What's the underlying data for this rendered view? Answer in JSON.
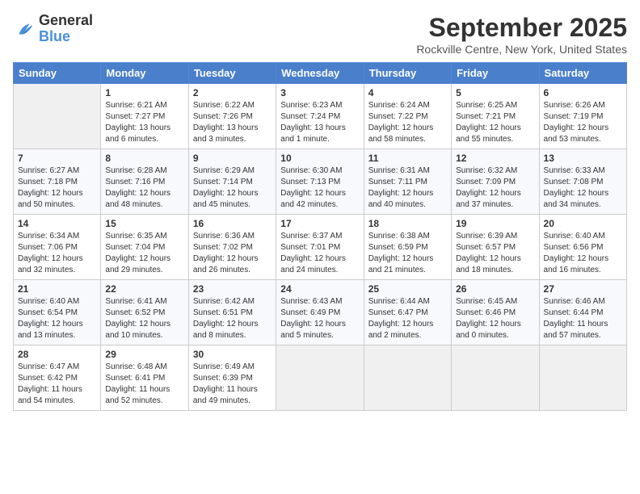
{
  "header": {
    "logo_general": "General",
    "logo_blue": "Blue",
    "month_year": "September 2025",
    "location": "Rockville Centre, New York, United States"
  },
  "days_of_week": [
    "Sunday",
    "Monday",
    "Tuesday",
    "Wednesday",
    "Thursday",
    "Friday",
    "Saturday"
  ],
  "weeks": [
    [
      {
        "day": "",
        "sunrise": "",
        "sunset": "",
        "daylight": ""
      },
      {
        "day": "1",
        "sunrise": "Sunrise: 6:21 AM",
        "sunset": "Sunset: 7:27 PM",
        "daylight": "Daylight: 13 hours and 6 minutes."
      },
      {
        "day": "2",
        "sunrise": "Sunrise: 6:22 AM",
        "sunset": "Sunset: 7:26 PM",
        "daylight": "Daylight: 13 hours and 3 minutes."
      },
      {
        "day": "3",
        "sunrise": "Sunrise: 6:23 AM",
        "sunset": "Sunset: 7:24 PM",
        "daylight": "Daylight: 13 hours and 1 minute."
      },
      {
        "day": "4",
        "sunrise": "Sunrise: 6:24 AM",
        "sunset": "Sunset: 7:22 PM",
        "daylight": "Daylight: 12 hours and 58 minutes."
      },
      {
        "day": "5",
        "sunrise": "Sunrise: 6:25 AM",
        "sunset": "Sunset: 7:21 PM",
        "daylight": "Daylight: 12 hours and 55 minutes."
      },
      {
        "day": "6",
        "sunrise": "Sunrise: 6:26 AM",
        "sunset": "Sunset: 7:19 PM",
        "daylight": "Daylight: 12 hours and 53 minutes."
      }
    ],
    [
      {
        "day": "7",
        "sunrise": "Sunrise: 6:27 AM",
        "sunset": "Sunset: 7:18 PM",
        "daylight": "Daylight: 12 hours and 50 minutes."
      },
      {
        "day": "8",
        "sunrise": "Sunrise: 6:28 AM",
        "sunset": "Sunset: 7:16 PM",
        "daylight": "Daylight: 12 hours and 48 minutes."
      },
      {
        "day": "9",
        "sunrise": "Sunrise: 6:29 AM",
        "sunset": "Sunset: 7:14 PM",
        "daylight": "Daylight: 12 hours and 45 minutes."
      },
      {
        "day": "10",
        "sunrise": "Sunrise: 6:30 AM",
        "sunset": "Sunset: 7:13 PM",
        "daylight": "Daylight: 12 hours and 42 minutes."
      },
      {
        "day": "11",
        "sunrise": "Sunrise: 6:31 AM",
        "sunset": "Sunset: 7:11 PM",
        "daylight": "Daylight: 12 hours and 40 minutes."
      },
      {
        "day": "12",
        "sunrise": "Sunrise: 6:32 AM",
        "sunset": "Sunset: 7:09 PM",
        "daylight": "Daylight: 12 hours and 37 minutes."
      },
      {
        "day": "13",
        "sunrise": "Sunrise: 6:33 AM",
        "sunset": "Sunset: 7:08 PM",
        "daylight": "Daylight: 12 hours and 34 minutes."
      }
    ],
    [
      {
        "day": "14",
        "sunrise": "Sunrise: 6:34 AM",
        "sunset": "Sunset: 7:06 PM",
        "daylight": "Daylight: 12 hours and 32 minutes."
      },
      {
        "day": "15",
        "sunrise": "Sunrise: 6:35 AM",
        "sunset": "Sunset: 7:04 PM",
        "daylight": "Daylight: 12 hours and 29 minutes."
      },
      {
        "day": "16",
        "sunrise": "Sunrise: 6:36 AM",
        "sunset": "Sunset: 7:02 PM",
        "daylight": "Daylight: 12 hours and 26 minutes."
      },
      {
        "day": "17",
        "sunrise": "Sunrise: 6:37 AM",
        "sunset": "Sunset: 7:01 PM",
        "daylight": "Daylight: 12 hours and 24 minutes."
      },
      {
        "day": "18",
        "sunrise": "Sunrise: 6:38 AM",
        "sunset": "Sunset: 6:59 PM",
        "daylight": "Daylight: 12 hours and 21 minutes."
      },
      {
        "day": "19",
        "sunrise": "Sunrise: 6:39 AM",
        "sunset": "Sunset: 6:57 PM",
        "daylight": "Daylight: 12 hours and 18 minutes."
      },
      {
        "day": "20",
        "sunrise": "Sunrise: 6:40 AM",
        "sunset": "Sunset: 6:56 PM",
        "daylight": "Daylight: 12 hours and 16 minutes."
      }
    ],
    [
      {
        "day": "21",
        "sunrise": "Sunrise: 6:40 AM",
        "sunset": "Sunset: 6:54 PM",
        "daylight": "Daylight: 12 hours and 13 minutes."
      },
      {
        "day": "22",
        "sunrise": "Sunrise: 6:41 AM",
        "sunset": "Sunset: 6:52 PM",
        "daylight": "Daylight: 12 hours and 10 minutes."
      },
      {
        "day": "23",
        "sunrise": "Sunrise: 6:42 AM",
        "sunset": "Sunset: 6:51 PM",
        "daylight": "Daylight: 12 hours and 8 minutes."
      },
      {
        "day": "24",
        "sunrise": "Sunrise: 6:43 AM",
        "sunset": "Sunset: 6:49 PM",
        "daylight": "Daylight: 12 hours and 5 minutes."
      },
      {
        "day": "25",
        "sunrise": "Sunrise: 6:44 AM",
        "sunset": "Sunset: 6:47 PM",
        "daylight": "Daylight: 12 hours and 2 minutes."
      },
      {
        "day": "26",
        "sunrise": "Sunrise: 6:45 AM",
        "sunset": "Sunset: 6:46 PM",
        "daylight": "Daylight: 12 hours and 0 minutes."
      },
      {
        "day": "27",
        "sunrise": "Sunrise: 6:46 AM",
        "sunset": "Sunset: 6:44 PM",
        "daylight": "Daylight: 11 hours and 57 minutes."
      }
    ],
    [
      {
        "day": "28",
        "sunrise": "Sunrise: 6:47 AM",
        "sunset": "Sunset: 6:42 PM",
        "daylight": "Daylight: 11 hours and 54 minutes."
      },
      {
        "day": "29",
        "sunrise": "Sunrise: 6:48 AM",
        "sunset": "Sunset: 6:41 PM",
        "daylight": "Daylight: 11 hours and 52 minutes."
      },
      {
        "day": "30",
        "sunrise": "Sunrise: 6:49 AM",
        "sunset": "Sunset: 6:39 PM",
        "daylight": "Daylight: 11 hours and 49 minutes."
      },
      {
        "day": "",
        "sunrise": "",
        "sunset": "",
        "daylight": ""
      },
      {
        "day": "",
        "sunrise": "",
        "sunset": "",
        "daylight": ""
      },
      {
        "day": "",
        "sunrise": "",
        "sunset": "",
        "daylight": ""
      },
      {
        "day": "",
        "sunrise": "",
        "sunset": "",
        "daylight": ""
      }
    ]
  ]
}
